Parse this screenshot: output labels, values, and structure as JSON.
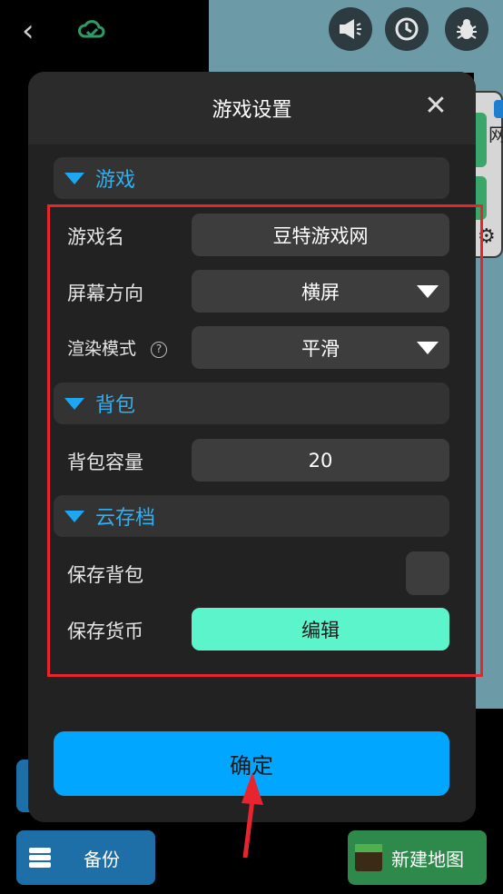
{
  "topbar": {
    "back_icon": "back-icon",
    "cloud_icon": "cloud-icon",
    "actions": [
      "announcement-icon",
      "history-icon",
      "bug-icon"
    ]
  },
  "background": {
    "card_text": "网",
    "backup_label": "备份",
    "new_map_label": "新建地图"
  },
  "dialog": {
    "title": "游戏设置",
    "close_icon": "close-icon",
    "sections": {
      "game": {
        "title": "游戏",
        "game_name_label": "游戏名",
        "game_name_value": "豆特游戏网",
        "orientation_label": "屏幕方向",
        "orientation_value": "横屏",
        "render_mode_label": "渲染模式",
        "render_mode_help": "?",
        "render_mode_value": "平滑"
      },
      "backpack": {
        "title": "背包",
        "capacity_label": "背包容量",
        "capacity_value": "20"
      },
      "cloud_save": {
        "title": "云存档",
        "save_backpack_label": "保存背包",
        "save_currency_label": "保存货币",
        "edit_label": "编辑"
      }
    },
    "confirm_label": "确定"
  },
  "colors": {
    "accent_blue": "#00a6ff",
    "section_title": "#2fb0f2",
    "edit_button": "#5cf5cb",
    "highlight": "#e8242f"
  }
}
